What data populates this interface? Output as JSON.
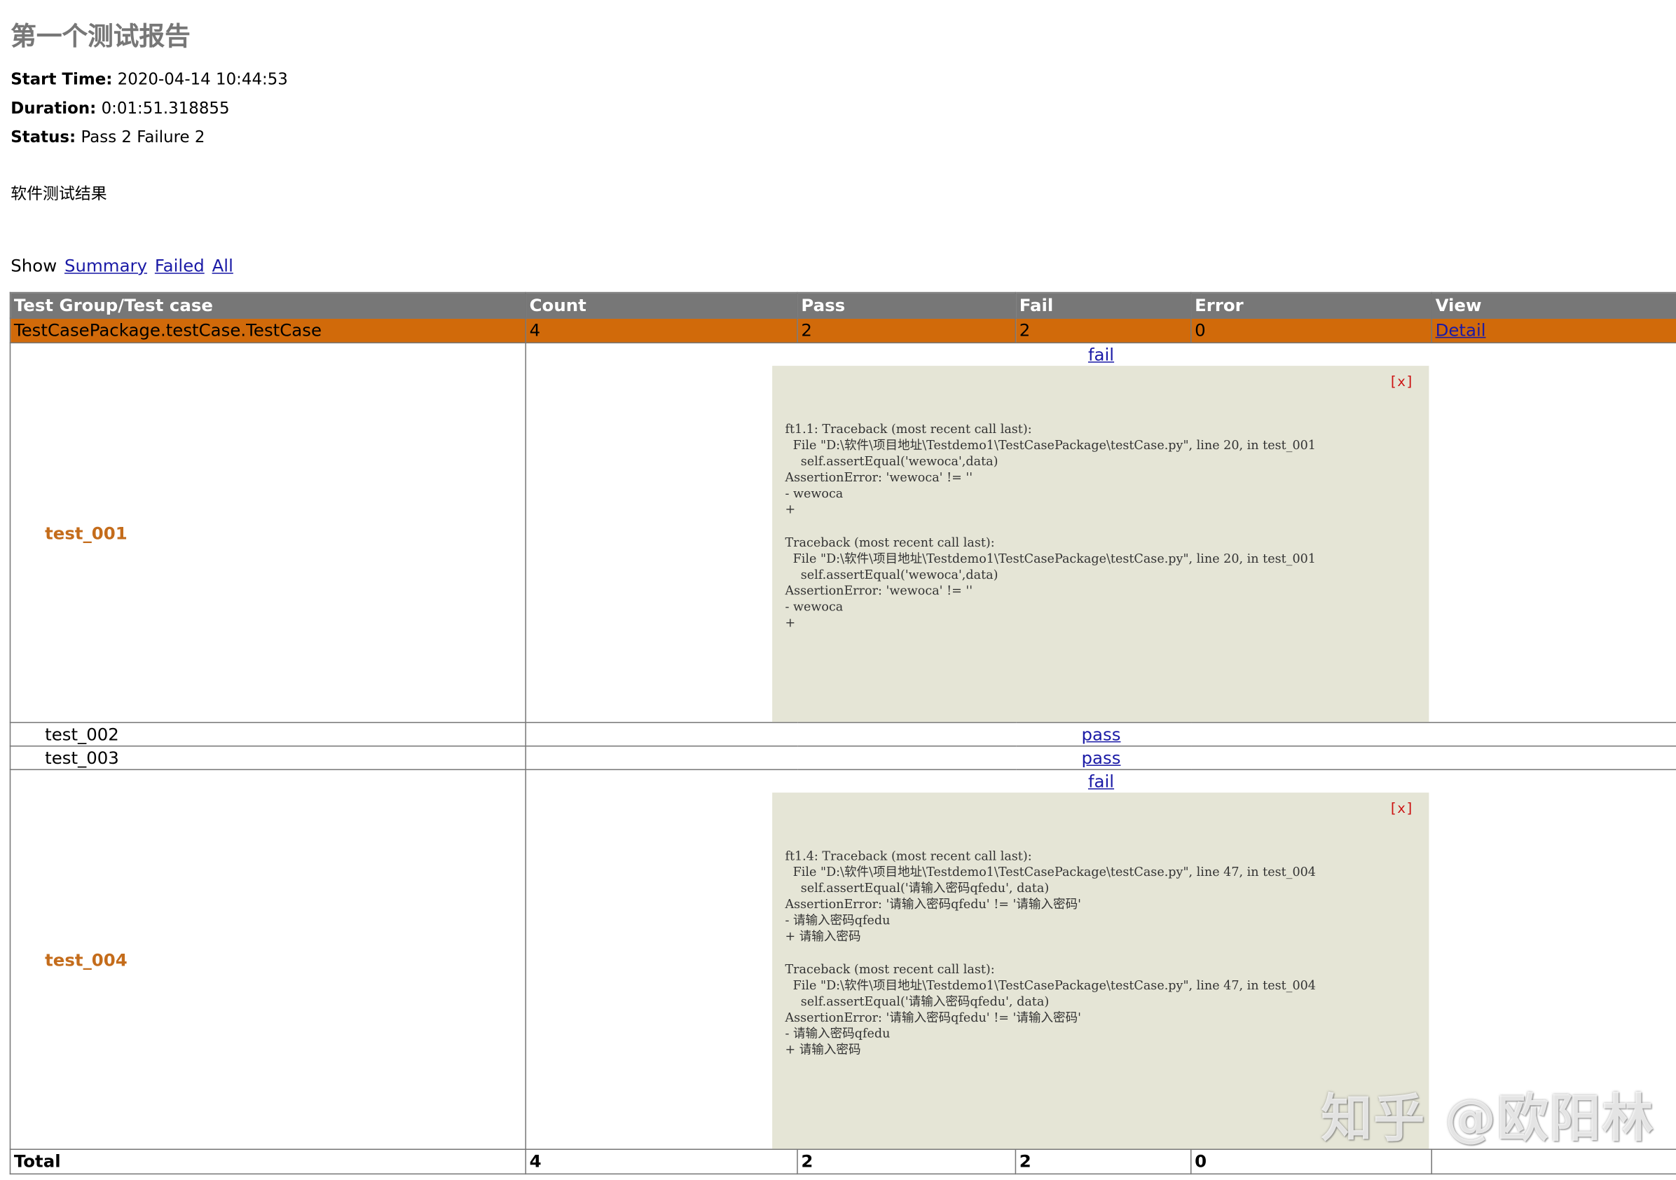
{
  "report": {
    "title": "第一个测试报告",
    "start_time_label": "Start Time:",
    "start_time": "2020-04-14 10:44:53",
    "duration_label": "Duration:",
    "duration": "0:01:51.318855",
    "status_label": "Status:",
    "status": "Pass 2 Failure 2",
    "description": "软件测试结果"
  },
  "filter": {
    "label": "Show",
    "summary": "Summary",
    "failed": "Failed",
    "all": "All"
  },
  "table": {
    "headers": [
      "Test Group/Test case",
      "Count",
      "Pass",
      "Fail",
      "Error",
      "View"
    ],
    "class_row": {
      "name": "TestCasePackage.testCase.TestCase",
      "count": "4",
      "pass": "2",
      "fail": "2",
      "error": "0",
      "view": "Detail"
    },
    "cases": [
      {
        "name": "test_001",
        "status": "fail",
        "close": "[x]",
        "trace": "ft1.1: Traceback (most recent call last):\n  File \"D:\\软件\\项目地址\\Testdemo1\\TestCasePackage\\testCase.py\", line 20, in test_001\n    self.assertEqual('wewoca',data)\nAssertionError: 'wewoca' != ''\n- wewoca\n+\n\nTraceback (most recent call last):\n  File \"D:\\软件\\项目地址\\Testdemo1\\TestCasePackage\\testCase.py\", line 20, in test_001\n    self.assertEqual('wewoca',data)\nAssertionError: 'wewoca' != ''\n- wewoca\n+"
      },
      {
        "name": "test_002",
        "status": "pass"
      },
      {
        "name": "test_003",
        "status": "pass"
      },
      {
        "name": "test_004",
        "status": "fail",
        "close": "[x]",
        "trace": "ft1.4: Traceback (most recent call last):\n  File \"D:\\软件\\项目地址\\Testdemo1\\TestCasePackage\\testCase.py\", line 47, in test_004\n    self.assertEqual('请输入密码qfedu', data)\nAssertionError: '请输入密码qfedu' != '请输入密码'\n- 请输入密码qfedu\n+ 请输入密码\n\nTraceback (most recent call last):\n  File \"D:\\软件\\项目地址\\Testdemo1\\TestCasePackage\\testCase.py\", line 47, in test_004\n    self.assertEqual('请输入密码qfedu', data)\nAssertionError: '请输入密码qfedu' != '请输入密码'\n- 请输入密码qfedu\n+ 请输入密码"
      }
    ],
    "total": {
      "label": "Total",
      "count": "4",
      "pass": "2",
      "fail": "2",
      "error": "0"
    }
  },
  "watermark": "知乎 @欧阳林"
}
